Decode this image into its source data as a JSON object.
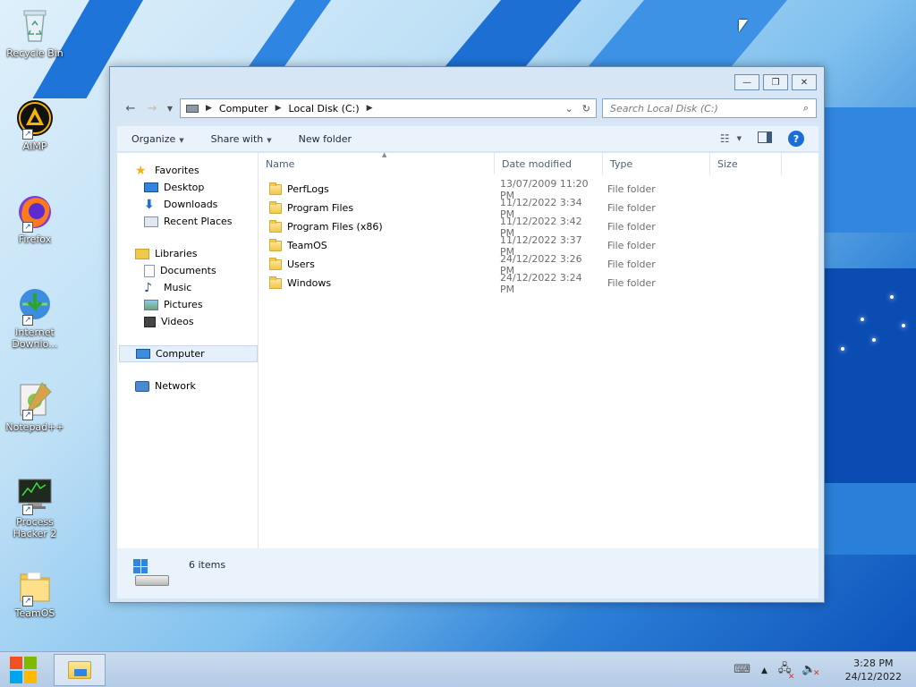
{
  "desktop": {
    "icons": [
      {
        "label": "Recycle Bin"
      },
      {
        "label": "AIMP"
      },
      {
        "label": "Firefox"
      },
      {
        "label": "Internet Downlo..."
      },
      {
        "label": "Notepad++"
      },
      {
        "label": "Process Hacker 2"
      },
      {
        "label": "TeamOS"
      }
    ]
  },
  "window": {
    "controls": {
      "minimize": "—",
      "maximize": "❐",
      "close": "✕"
    },
    "address": {
      "segments": [
        "Computer",
        "Local Disk (C:)"
      ]
    },
    "search": {
      "placeholder": "Search Local Disk (C:)"
    },
    "toolbar": {
      "organize": "Organize",
      "share_with": "Share with",
      "new_folder": "New folder"
    },
    "nav": {
      "favorites": "Favorites",
      "favorites_items": [
        "Desktop",
        "Downloads",
        "Recent Places"
      ],
      "libraries": "Libraries",
      "libraries_items": [
        "Documents",
        "Music",
        "Pictures",
        "Videos"
      ],
      "computer": "Computer",
      "network": "Network"
    },
    "columns": {
      "name": "Name",
      "date": "Date modified",
      "type": "Type",
      "size": "Size"
    },
    "files": [
      {
        "name": "PerfLogs",
        "date": "13/07/2009 11:20 PM",
        "type": "File folder"
      },
      {
        "name": "Program Files",
        "date": "11/12/2022 3:34 PM",
        "type": "File folder"
      },
      {
        "name": "Program Files (x86)",
        "date": "11/12/2022 3:42 PM",
        "type": "File folder"
      },
      {
        "name": "TeamOS",
        "date": "11/12/2022 3:37 PM",
        "type": "File folder"
      },
      {
        "name": "Users",
        "date": "24/12/2022 3:26 PM",
        "type": "File folder"
      },
      {
        "name": "Windows",
        "date": "24/12/2022 3:24 PM",
        "type": "File folder"
      }
    ],
    "status": {
      "count": "6 items"
    }
  },
  "taskbar": {
    "time": "3:28 PM",
    "date": "24/12/2022"
  },
  "colors": {
    "accent": "#1a6fd6",
    "window_frame": "#d7e6f5",
    "folder": "#f2c84b"
  }
}
